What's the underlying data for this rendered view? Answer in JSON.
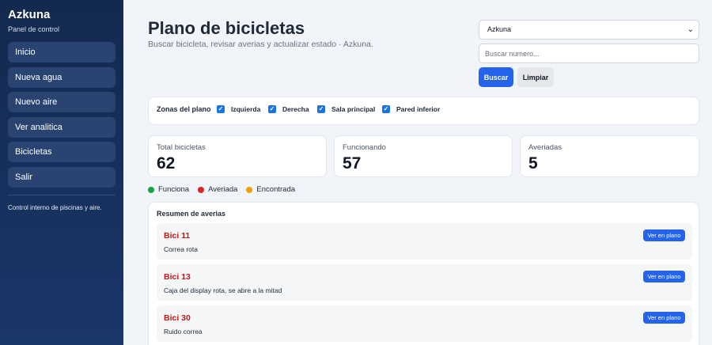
{
  "sidebar": {
    "brand": "Azkuna",
    "subtitle": "Panel de control",
    "items": [
      {
        "label": "Inicio"
      },
      {
        "label": "Nueva agua"
      },
      {
        "label": "Nuevo aire"
      },
      {
        "label": "Ver analitica"
      },
      {
        "label": "Bicicletas"
      },
      {
        "label": "Salir"
      }
    ],
    "footer": "Control interno de piscinas y aire."
  },
  "header": {
    "title": "Plano de bicicletas",
    "subtitle": "Buscar bicicleta, revisar averias y actualizar estado · Azkuna."
  },
  "controls": {
    "tenant_selected": "Azkuna",
    "search_placeholder": "Buscar numero...",
    "search_value": "",
    "search_button": "Buscar",
    "clear_button": "Limpiar"
  },
  "zones": {
    "label": "Zonas del plano",
    "items": [
      {
        "label": "Izquierda",
        "checked": true
      },
      {
        "label": "Derecha",
        "checked": true
      },
      {
        "label": "Sala principal",
        "checked": true
      },
      {
        "label": "Pared inferior",
        "checked": true
      }
    ]
  },
  "stats": [
    {
      "label": "Total bicicletas",
      "value": "62"
    },
    {
      "label": "Funcionando",
      "value": "57"
    },
    {
      "label": "Averiadas",
      "value": "5"
    }
  ],
  "legend": [
    {
      "label": "Funciona",
      "color": "#16a34a"
    },
    {
      "label": "Averiada",
      "color": "#dc2626"
    },
    {
      "label": "Encontrada",
      "color": "#f59e0b"
    }
  ],
  "summary": {
    "title": "Resumen de averias",
    "button_label": "Ver en plano",
    "items": [
      {
        "title": "Bici 11",
        "desc": "Correa rota"
      },
      {
        "title": "Bici 13",
        "desc": "Caja del display rota, se abre a la mitad"
      },
      {
        "title": "Bici 30",
        "desc": "Ruido correa"
      }
    ]
  }
}
